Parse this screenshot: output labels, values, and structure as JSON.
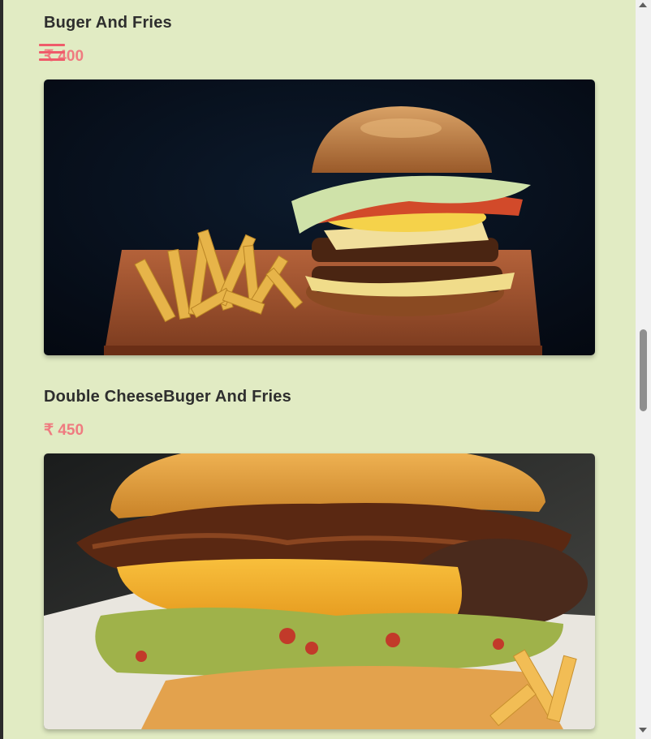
{
  "menu_items": [
    {
      "title": "Buger And Fries",
      "price": "₹ 400"
    },
    {
      "title": "Double CheeseBuger And Fries",
      "price": "₹ 450"
    }
  ],
  "colors": {
    "page_background": "#e1ebc3",
    "title_text": "#2e2e2e",
    "price_text": "#ef7b80",
    "menu_icon": "#ef5b6a"
  },
  "icons": {
    "menu": "hamburger-menu-icon"
  }
}
